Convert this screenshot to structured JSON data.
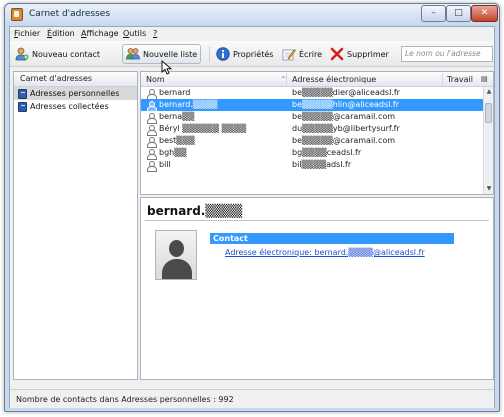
{
  "window": {
    "title": "Carnet d'adresses"
  },
  "menu": [
    {
      "label": "Fichier",
      "underline": "F",
      "rest": "ichier"
    },
    {
      "label": "Édition",
      "underline": "É",
      "rest": "dition"
    },
    {
      "label": "Affichage",
      "underline": "A",
      "rest": "ffichage"
    },
    {
      "label": "Outils",
      "underline": "O",
      "rest": "utils"
    },
    {
      "label": "?",
      "underline": "?",
      "rest": ""
    }
  ],
  "toolbar": {
    "new_contact": "Nouveau contact",
    "new_list": "Nouvelle liste",
    "properties": "Propriétés",
    "write": "Écrire",
    "delete": "Supprimer",
    "search_placeholder": "Le nom ou l'adresse"
  },
  "sidebar": {
    "header": "Carnet d'adresses",
    "items": [
      {
        "label": "Adresses personnelles",
        "selected": true
      },
      {
        "label": "Adresses collectées",
        "selected": false
      }
    ]
  },
  "list": {
    "columns": {
      "name": "Nom",
      "email": "Adresse électronique",
      "work": "Travail"
    },
    "rows": [
      {
        "name": "bernard",
        "email": "be▒▒▒▒▒dier@aliceadsl.fr",
        "selected": false
      },
      {
        "name": "bernard.▒▒▒▒",
        "email": "be▒▒▒▒▒hlin@aliceadsl.fr",
        "selected": true
      },
      {
        "name": "berna▒▒",
        "email": "be▒▒▒▒▒@caramail.com",
        "selected": false
      },
      {
        "name": "Béryl ▒▒▒▒▒▒ ▒▒▒▒",
        "email": "du▒▒▒▒▒yb@libertysurf.fr",
        "selected": false
      },
      {
        "name": "best▒▒▒",
        "email": "be▒▒▒▒▒@caramail.com",
        "selected": false
      },
      {
        "name": "bgh▒▒",
        "email": "bg▒▒▒▒ceadsl.fr",
        "selected": false
      },
      {
        "name": "bill",
        "email": "bil▒▒▒▒adsl.fr",
        "selected": false
      }
    ]
  },
  "card": {
    "name": "bernard.▒▒▒▒",
    "section_title": "Contact",
    "email_line": "Adresse électronique: bernard.▒▒▒▒@aliceadsl.fr"
  },
  "status": {
    "text": "Nombre de contacts dans Adresses personnelles : 992"
  },
  "colors": {
    "selection": "#3399ff",
    "link": "#1b4fd1",
    "delete_icon": "#d02020"
  }
}
